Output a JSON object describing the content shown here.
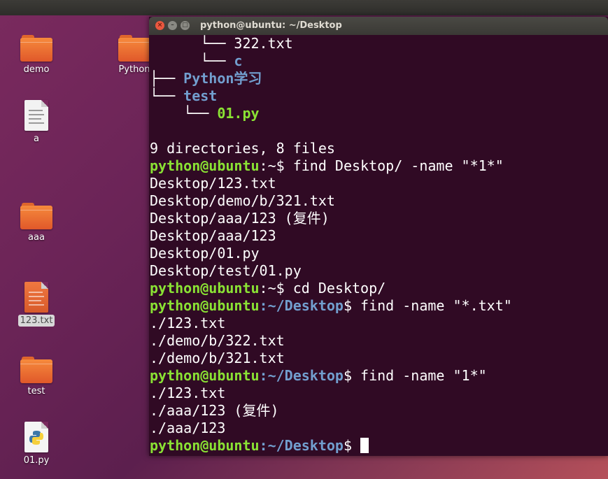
{
  "desktop": {
    "icons": [
      {
        "label": "demo",
        "kind": "folder"
      },
      {
        "label": "Python",
        "kind": "folder"
      },
      {
        "label": "a",
        "kind": "text-file"
      },
      {
        "label": "aaa",
        "kind": "folder"
      },
      {
        "label": "123.txt",
        "kind": "text-file-selected"
      },
      {
        "label": "test",
        "kind": "folder"
      },
      {
        "label": "01.py",
        "kind": "python-file"
      }
    ]
  },
  "terminal": {
    "title": "python@ubuntu: ~/Desktop",
    "buttons": {
      "close": "×",
      "minimize": "–",
      "maximize": "□"
    },
    "tree": {
      "l1_branch": "      └── ",
      "l1_name": "322.txt",
      "l2_branch": "      └── ",
      "l2_name": "c",
      "l3_branch": "├── ",
      "l3_name": "Python学习",
      "l4_branch": "└── ",
      "l4_name": "test",
      "l5_branch": "    └── ",
      "l5_name": "01.py"
    },
    "summary": "9 directories, 8 files",
    "prompt_user": "python@ubuntu",
    "cmd1": "$ find Desktop/ -name \"*1*\"",
    "out1": [
      "Desktop/123.txt",
      "Desktop/demo/b/321.txt",
      "Desktop/aaa/123 (复件)",
      "Desktop/aaa/123",
      "Desktop/01.py",
      "Desktop/test/01.py"
    ],
    "cmd2": "$ cd Desktop/",
    "path_home": ":~",
    "path_desktop": ":~/Desktop",
    "cmd3": "$ find -name \"*.txt\"",
    "out3": [
      "./123.txt",
      "./demo/b/322.txt",
      "./demo/b/321.txt"
    ],
    "cmd4": "$ find -name \"1*\"",
    "out4": [
      "./123.txt",
      "./aaa/123 (复件)",
      "./aaa/123"
    ],
    "final_prompt_tail": "$ ",
    "colors": {
      "background": "#300a24",
      "user": "#8ae234",
      "dir": "#729fcf",
      "text": "#ffffff"
    }
  }
}
